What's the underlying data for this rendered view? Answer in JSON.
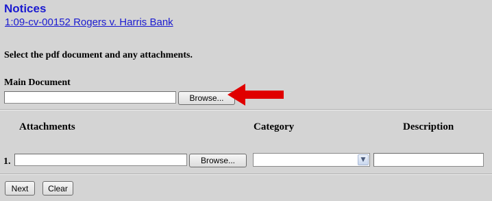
{
  "header": {
    "title": "Notices",
    "case_link": "1:09-cv-00152 Rogers v. Harris Bank"
  },
  "instructions": "Select the pdf document and any attachments.",
  "main_document": {
    "label": "Main Document",
    "file_value": "",
    "browse_label": "Browse..."
  },
  "attachments": {
    "columns": [
      "Attachments",
      "Category",
      "Description"
    ],
    "rows": [
      {
        "number": "1.",
        "file_value": "",
        "browse_label": "Browse...",
        "category": "",
        "description": ""
      }
    ]
  },
  "actions": {
    "next_label": "Next",
    "clear_label": "Clear"
  },
  "colors": {
    "link": "#1a1ad0",
    "annotation_arrow": "#e00000",
    "background": "#d4d4d4"
  }
}
